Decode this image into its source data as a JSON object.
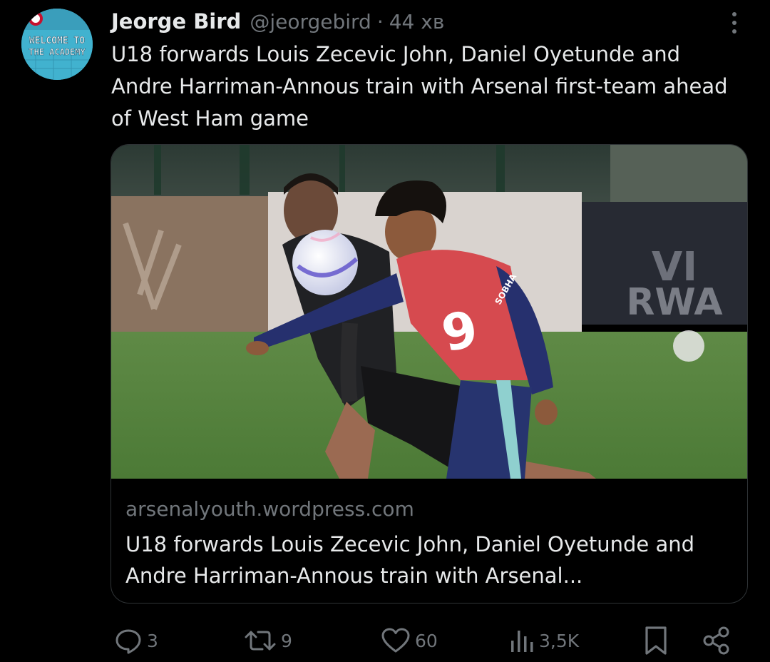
{
  "author": {
    "display_name": "Jeorge Bird",
    "handle": "@jeorgebird",
    "separator": "·",
    "timestamp": "44 хв",
    "avatar": {
      "line1": "WELCOME TO",
      "line2": "THE ACADEMY"
    }
  },
  "tweet": {
    "text": "U18 forwards Louis Zecevic John, Daniel Oyetunde and Andre Harriman-Annous train with Arsenal first-team ahead of West Ham game"
  },
  "card": {
    "domain": "arsenalyouth.wordpress.com",
    "title": "U18 forwards Louis Zecevic John, Daniel Oyetunde and Andre Harriman-Annous train with Arsenal...",
    "image": {
      "description_hidden": "",
      "bib_number": "9",
      "board_text_1": "VI",
      "board_text_2": "RWA",
      "shirt_text": "SOBHA"
    }
  },
  "actions": {
    "replies": "3",
    "reposts": "9",
    "likes": "60",
    "views": "3,5K"
  },
  "icons": {
    "more": "more-vertical-icon",
    "reply": "reply-icon",
    "repost": "repost-icon",
    "like": "heart-icon",
    "views": "views-icon",
    "bookmark": "bookmark-icon",
    "share": "share-icon"
  },
  "colors": {
    "background": "#000000",
    "text_primary": "#e7e9ea",
    "text_secondary": "#71767b",
    "border": "#2f3336"
  }
}
